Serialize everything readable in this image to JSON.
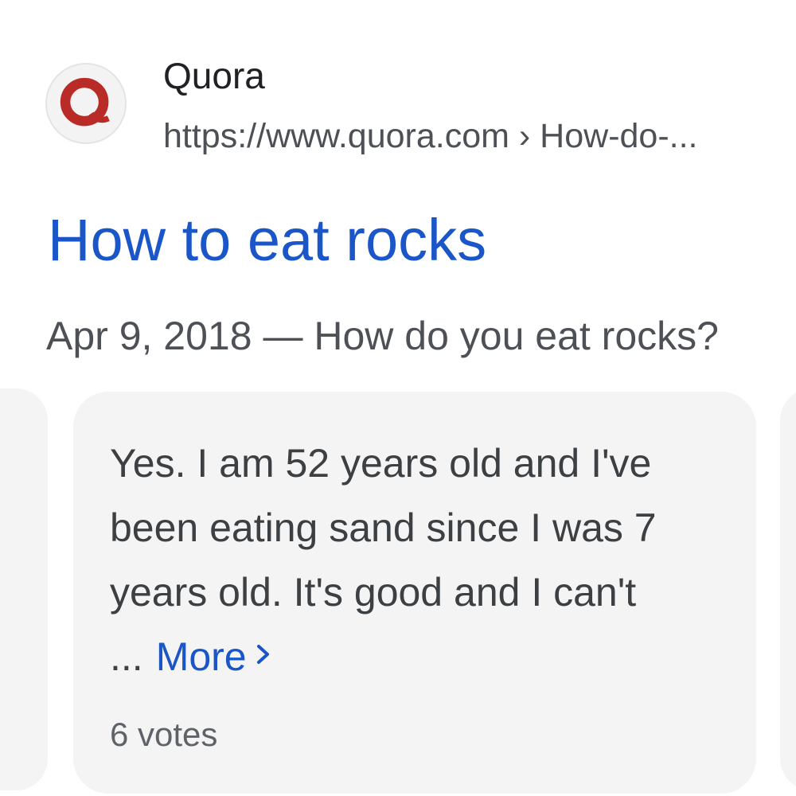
{
  "result": {
    "site_name": "Quora",
    "url": "https://www.quora.com › How-do-...",
    "title": "How to eat rocks",
    "date": "Apr 9, 2018",
    "separator": "—",
    "question": "How do you eat rocks?",
    "favicon_icon": "quora-logo-icon"
  },
  "answer_card": {
    "text": "Yes. I am 52 years old and I've been eating sand since I was 7 years old. It's good and I can't ...",
    "more_label": "More",
    "more_icon": "chevron-right-icon",
    "votes": "6 votes"
  },
  "colors": {
    "link_blue": "#1a56c8",
    "quora_red": "#b92b27",
    "card_background": "#f4f4f5"
  }
}
